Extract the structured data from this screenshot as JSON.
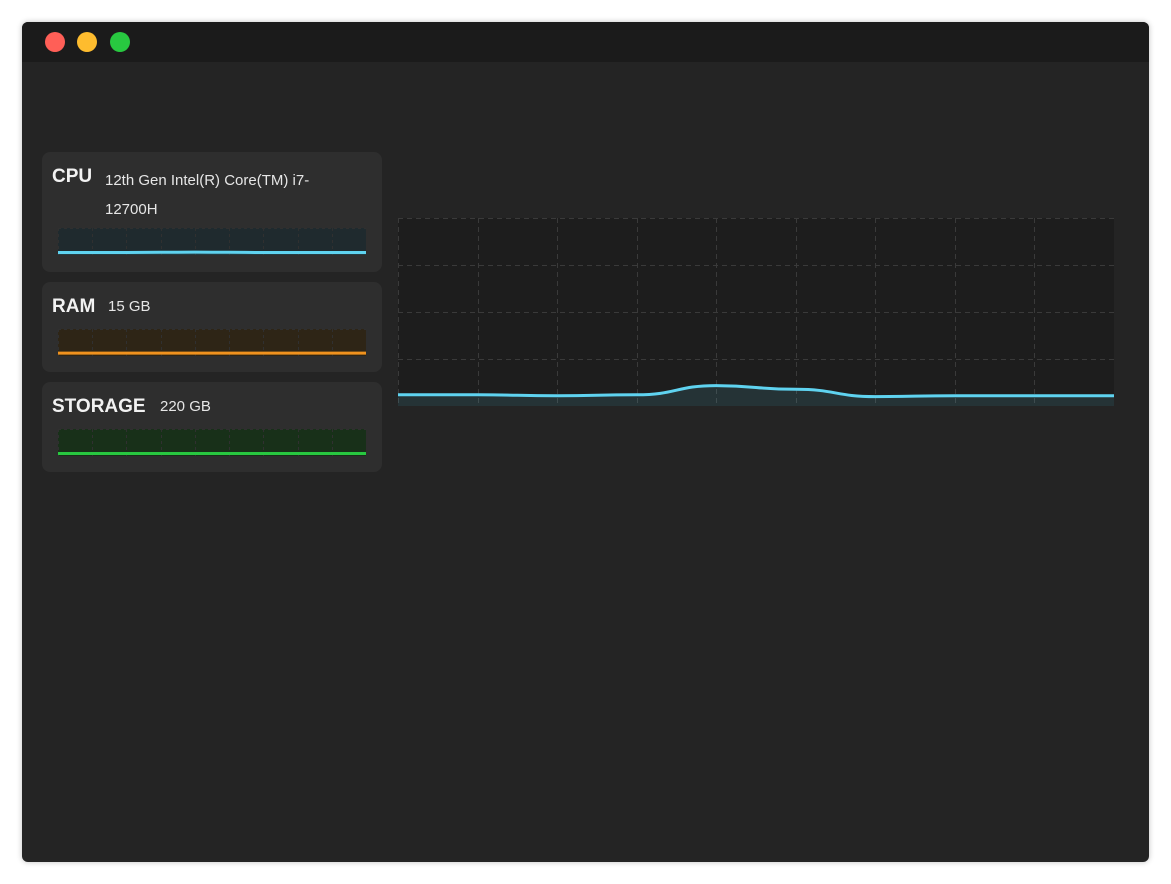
{
  "window": {
    "traffic_lights": [
      {
        "name": "close",
        "color": "#ff5f57"
      },
      {
        "name": "minimize",
        "color": "#febc2e"
      },
      {
        "name": "zoom",
        "color": "#28c840"
      }
    ]
  },
  "cards": {
    "cpu": {
      "name": "CPU",
      "detail": "12th Gen Intel(R) Core(TM) i7-12700H",
      "color": "#5fd3f0"
    },
    "ram": {
      "name": "RAM",
      "detail": "15 GB",
      "color": "#f0921e"
    },
    "storage": {
      "name": "STORAGE",
      "detail": "220 GB",
      "color": "#28c840"
    }
  },
  "chart_data": [
    {
      "type": "area",
      "series": [
        {
          "values": [
            2,
            2,
            2,
            3,
            4,
            3,
            2,
            2,
            2,
            2
          ]
        }
      ],
      "ylim": [
        0,
        100
      ],
      "grid": true
    },
    {
      "type": "line",
      "series": [
        {
          "values": [
            4,
            4,
            4,
            4,
            4,
            4,
            4,
            4,
            4,
            4
          ]
        }
      ],
      "ylim": [
        0,
        100
      ],
      "grid": true
    },
    {
      "type": "line",
      "series": [
        {
          "values": [
            2,
            2,
            2,
            2,
            2,
            2,
            2,
            2,
            2,
            2
          ]
        }
      ],
      "ylim": [
        0,
        100
      ],
      "grid": true
    },
    {
      "type": "area",
      "x": [
        0,
        1,
        2,
        3,
        4,
        5,
        6,
        7,
        8,
        9
      ],
      "series": [
        {
          "values": [
            5,
            5,
            4.5,
            5,
            10,
            8,
            4,
            4.5,
            4.5,
            4.5
          ]
        }
      ],
      "ylim": [
        0,
        100
      ],
      "grid": true
    }
  ]
}
